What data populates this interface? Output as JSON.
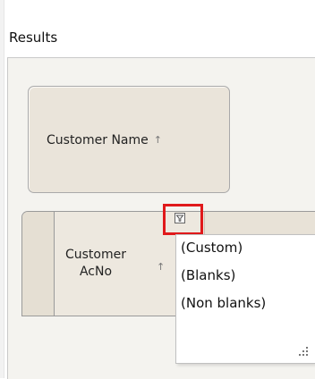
{
  "results": {
    "label": "Results"
  },
  "group_by_area": {
    "column_label": "Customer Name",
    "sort_icon": "sort-ascending-icon"
  },
  "grid": {
    "column_header": {
      "label_line1": "Customer",
      "label_line2": "AcNo",
      "sort_icon": "sort-ascending-icon",
      "filter_icon": "filter-icon",
      "filter_highlight_color": "#e0191b"
    }
  },
  "filter_dropdown": {
    "items": [
      "(Custom)",
      "(Blanks)",
      "(Non blanks)"
    ],
    "resize_icon": "resize-grip-icon"
  }
}
